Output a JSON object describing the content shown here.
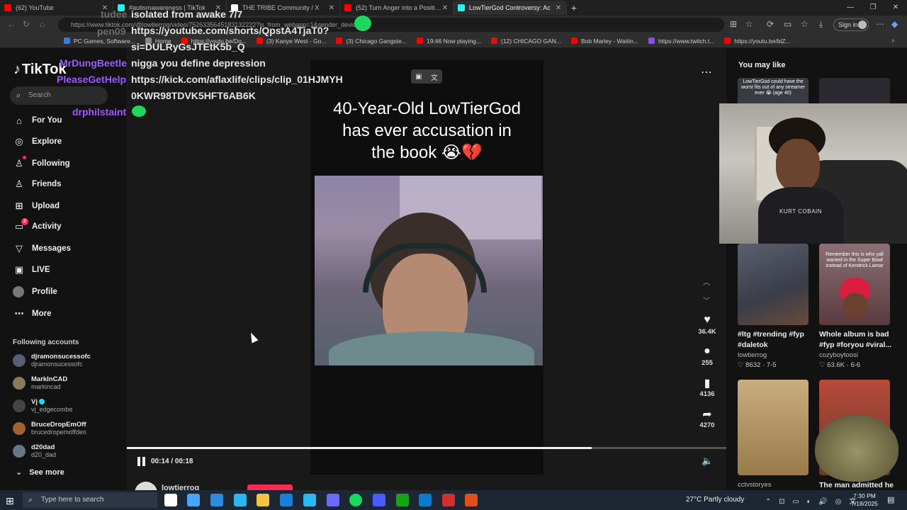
{
  "browser": {
    "tabs": [
      {
        "title": "(62) YouTube",
        "color": "#ff0000",
        "active": false
      },
      {
        "title": "#autismawareness | TikTok",
        "color": "#25f4ee",
        "active": false
      },
      {
        "title": "THE TRIBE Community / X",
        "color": "#ffffff",
        "active": false
      },
      {
        "title": "(52) Turn Anger into a Positive Fo",
        "color": "#ff0000",
        "active": false
      },
      {
        "title": "LowTierGod Controversy: Ac",
        "color": "#25f4ee",
        "active": true
      }
    ],
    "url": "https://www.tiktok.com/@lowtierrog/video/7526335645183132222?is_from_webapp=1&sender_device=pc",
    "sign_in": "Sign in",
    "bookmarks": [
      {
        "label": "PC Games, Software...",
        "color": "#3a7bd5"
      },
      {
        "label": "Home",
        "color": "#888888"
      },
      {
        "label": "https://youtu.be/Do...",
        "color": "#ff0000"
      },
      {
        "label": "(3) Kanye West - Go...",
        "color": "#ff0000"
      },
      {
        "label": "(3) Chicago Gangste...",
        "color": "#ff0000"
      },
      {
        "label": "19:46 Now playing...",
        "color": "#ff0000"
      },
      {
        "label": "(12) CHICAGO GAN...",
        "color": "#ff0000"
      },
      {
        "label": "Bob Marley - Waitin...",
        "color": "#ff0000"
      },
      {
        "label": "https://www.twitch.t...",
        "color": "#9146ff"
      },
      {
        "label": "https://youtu.be/blZ...",
        "color": "#ff0000"
      }
    ]
  },
  "chat": [
    {
      "user": "tudee",
      "user_color": "#c0c0c0",
      "msg": "isolated from awake 7/7"
    },
    {
      "user": "pen09",
      "user_color": "#c0c0c0",
      "msg": "https://youtube.com/shorts/QpstA4TjaT0?"
    },
    {
      "user": "",
      "user_color": "#c0c0c0",
      "msg": "si=DULRyGsJTEtK5b_Q"
    },
    {
      "user": "MrDungBeetle",
      "user_color": "#9b59ff",
      "msg": "nigga you define depression"
    },
    {
      "user": "PleaseGetHelp",
      "user_color": "#9b59ff",
      "msg": "https://kick.com/aflaxlife/clips/clip_01HJMYH"
    },
    {
      "user": "",
      "user_color": "#9b59ff",
      "msg": "0KWR98TDVK5HFT6AB6K"
    },
    {
      "user": "drphilstaint",
      "user_color": "#9b59ff",
      "msg": ""
    }
  ],
  "sidebar": {
    "logo": "TikTok",
    "search_placeholder": "Search",
    "nav": [
      {
        "label": "For You",
        "icon": "home-icon",
        "glyph": "⌂"
      },
      {
        "label": "Explore",
        "icon": "compass-icon",
        "glyph": "◎"
      },
      {
        "label": "Following",
        "icon": "following-icon",
        "glyph": "👤"
      },
      {
        "label": "Friends",
        "icon": "friends-icon",
        "glyph": "👥"
      },
      {
        "label": "Upload",
        "icon": "upload-icon",
        "glyph": "⊞"
      },
      {
        "label": "Activity",
        "icon": "activity-icon",
        "glyph": "▭",
        "badge": "2"
      },
      {
        "label": "Messages",
        "icon": "messages-icon",
        "glyph": "▽"
      },
      {
        "label": "LIVE",
        "icon": "live-icon",
        "glyph": "▣"
      },
      {
        "label": "Profile",
        "icon": "avatar",
        "glyph": ""
      },
      {
        "label": "More",
        "icon": "more-icon",
        "glyph": "⋯"
      }
    ],
    "following_title": "Following accounts",
    "following": [
      {
        "name": "djramonsucessofc",
        "handle": "djramonsucessofc",
        "color": "#556070",
        "verified": false
      },
      {
        "name": "MarkInCAD",
        "handle": "markincad",
        "color": "#8a7a5a",
        "verified": false
      },
      {
        "name": "Vj",
        "handle": "vj_edgecombe",
        "color": "#444444",
        "verified": true
      },
      {
        "name": "BruceDropEmOff",
        "handle": "brucedropemoffdeo",
        "color": "#a06030",
        "verified": false
      },
      {
        "name": "d20dad",
        "handle": "d20_dad",
        "color": "#667788",
        "verified": false
      }
    ],
    "see_more": "See more"
  },
  "video": {
    "caption_lines": [
      "40-Year-Old LowTierGod",
      "has ever accusation in",
      "the book 😭💔"
    ],
    "time": "00:14 / 00:18",
    "progress": 0.775,
    "author": "lowtierrog",
    "actions": [
      {
        "icon": "heart-icon",
        "glyph": "♥",
        "count": "36.4K"
      },
      {
        "icon": "comment-icon",
        "glyph": "💬",
        "count": "255"
      },
      {
        "icon": "bookmark-icon",
        "glyph": "🔖",
        "count": "4136"
      },
      {
        "icon": "share-icon",
        "glyph": "➦",
        "count": "4270"
      }
    ]
  },
  "you_may_like": {
    "title": "You may like",
    "top_caption": "LowTierGod could have the worst fits out of any streamer ever 😭 (age 40)",
    "items": [
      {
        "title": "#ltg #trending #fyp #daletok",
        "user": "lowtierrog",
        "likes": "8632",
        "date": "7-5",
        "bg": "#4a4f5e",
        "overlay": ""
      },
      {
        "title": "Whole album is bad #fyp #foryou #viral...",
        "user": "cozyboytoosi",
        "likes": "63.6K",
        "date": "6-6",
        "bg": "#6a5058",
        "overlay": "Remember this is who yall wanted in the Super Bowl instead of Kendrick Lamar"
      },
      {
        "title": "",
        "user": "cctvstoryes",
        "likes": "",
        "date": "",
        "bg": "#b89a6a",
        "overlay": ""
      },
      {
        "title": "The man admitted he",
        "user": "",
        "likes": "",
        "date": "",
        "bg": "#7a4a3a",
        "overlay": ""
      }
    ]
  },
  "webcam": {
    "shirt_text": "KURT COBAIN"
  },
  "taskbar": {
    "search_placeholder": "Type here to search",
    "weather": "27°C  Partly cloudy",
    "time": "7:30 PM",
    "date": "7/18/2025",
    "apps": [
      "#ffffff",
      "#4aa3ff",
      "#2e8be0",
      "#f3c542",
      "#1a7fd6",
      "#2bb8f0",
      "#6a6aff",
      "#1ed760",
      "#4b5bff",
      "#16a316",
      "#0a7cd0",
      "#d03030",
      "#e0501a"
    ]
  }
}
